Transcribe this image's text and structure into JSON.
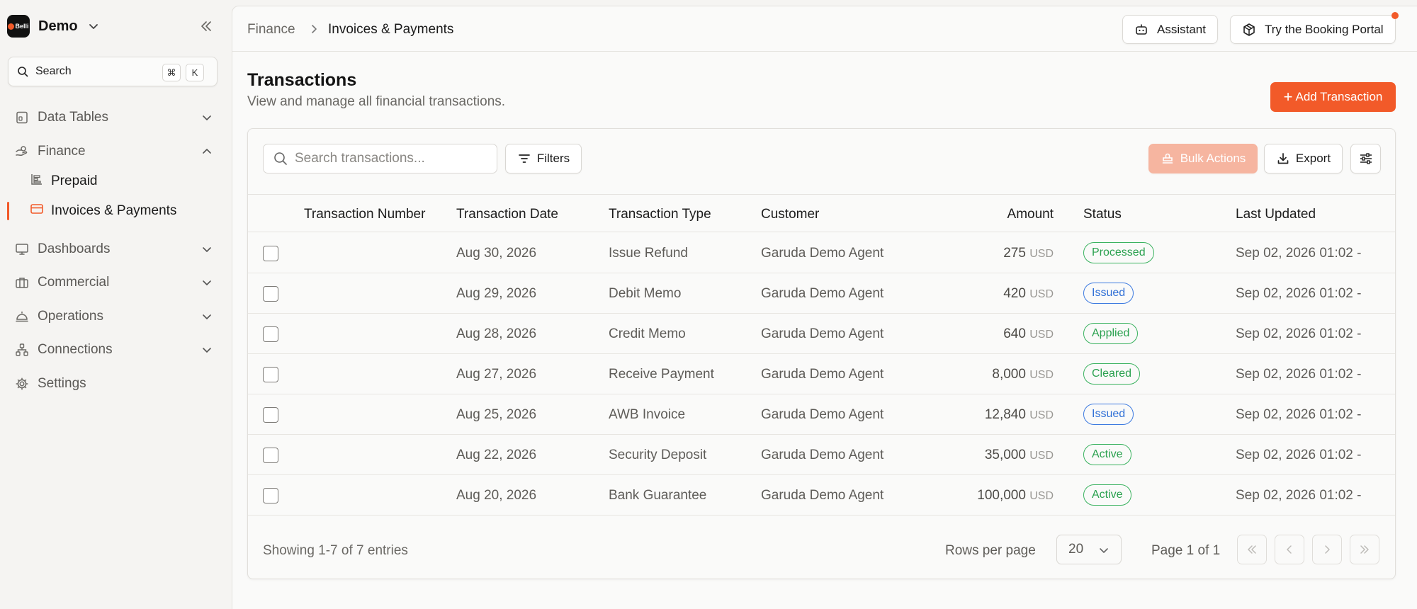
{
  "sidebar": {
    "brand": {
      "logo_text": "Belli",
      "name": "Demo"
    },
    "search": {
      "label": "Search",
      "kbd_1": "⌘",
      "kbd_2": "K"
    },
    "items": [
      {
        "label": "Data Tables",
        "icon": "data-tables-icon"
      },
      {
        "label": "Finance",
        "icon": "finance-icon",
        "expanded": true,
        "children": [
          {
            "label": "Prepaid",
            "icon": "prepaid-icon"
          },
          {
            "label": "Invoices & Payments",
            "icon": "card-icon",
            "active": true
          }
        ]
      },
      {
        "label": "Dashboards",
        "icon": "monitor-icon"
      },
      {
        "label": "Commercial",
        "icon": "briefcase-icon"
      },
      {
        "label": "Operations",
        "icon": "service-bell-icon"
      },
      {
        "label": "Connections",
        "icon": "network-icon"
      },
      {
        "label": "Settings",
        "icon": "gear-icon"
      }
    ]
  },
  "header": {
    "breadcrumb": [
      "Finance",
      "Invoices & Payments"
    ],
    "assistant_label": "Assistant",
    "booking_label": "Try the Booking Portal"
  },
  "page": {
    "title": "Transactions",
    "subtitle": "View and manage all financial transactions.",
    "add_label": "Add Transaction"
  },
  "toolbar": {
    "search_placeholder": "Search transactions...",
    "filters_label": "Filters",
    "bulk_label": "Bulk Actions",
    "export_label": "Export"
  },
  "table": {
    "columns": [
      "Transaction Number",
      "Transaction Date",
      "Transaction Type",
      "Customer",
      "Amount",
      "Status",
      "Last Updated"
    ],
    "rows": [
      {
        "number": "",
        "date": "Aug 30, 2026",
        "type": "Issue Refund",
        "customer": "Garuda Demo Agent",
        "amount": "275",
        "currency": "USD",
        "status": "Processed",
        "status_color": "green",
        "updated": "Sep 02, 2026 01:02 -"
      },
      {
        "number": "",
        "date": "Aug 29, 2026",
        "type": "Debit Memo",
        "customer": "Garuda Demo Agent",
        "amount": "420",
        "currency": "USD",
        "status": "Issued",
        "status_color": "blue",
        "updated": "Sep 02, 2026 01:02 -"
      },
      {
        "number": "",
        "date": "Aug 28, 2026",
        "type": "Credit Memo",
        "customer": "Garuda Demo Agent",
        "amount": "640",
        "currency": "USD",
        "status": "Applied",
        "status_color": "green",
        "updated": "Sep 02, 2026 01:02 -"
      },
      {
        "number": "",
        "date": "Aug 27, 2026",
        "type": "Receive Payment",
        "customer": "Garuda Demo Agent",
        "amount": "8,000",
        "currency": "USD",
        "status": "Cleared",
        "status_color": "green",
        "updated": "Sep 02, 2026 01:02 -"
      },
      {
        "number": "",
        "date": "Aug 25, 2026",
        "type": "AWB Invoice",
        "customer": "Garuda Demo Agent",
        "amount": "12,840",
        "currency": "USD",
        "status": "Issued",
        "status_color": "blue",
        "updated": "Sep 02, 2026 01:02 -"
      },
      {
        "number": "",
        "date": "Aug 22, 2026",
        "type": "Security Deposit",
        "customer": "Garuda Demo Agent",
        "amount": "35,000",
        "currency": "USD",
        "status": "Active",
        "status_color": "green",
        "updated": "Sep 02, 2026 01:02 -"
      },
      {
        "number": "",
        "date": "Aug 20, 2026",
        "type": "Bank Guarantee",
        "customer": "Garuda Demo Agent",
        "amount": "100,000",
        "currency": "USD",
        "status": "Active",
        "status_color": "green",
        "updated": "Sep 02, 2026 01:02 -"
      }
    ]
  },
  "footer": {
    "showing": "Showing 1-7 of 7 entries",
    "rows_per_page_label": "Rows per page",
    "rows_per_page_value": "20",
    "page_info": "Page 1 of 1"
  },
  "colors": {
    "accent": "#f25a29",
    "status_green": "#2aa14f",
    "status_blue": "#2f6fd6"
  }
}
